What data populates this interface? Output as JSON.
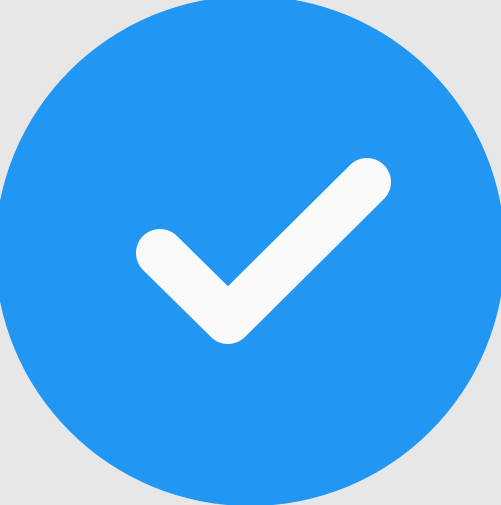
{
  "icon": {
    "name": "check-circle-icon",
    "shape": "filled circle with checkmark"
  },
  "colors": {
    "background": "#e7e7e7",
    "circle": "#2196f3",
    "checkmark": "#fafafa"
  }
}
